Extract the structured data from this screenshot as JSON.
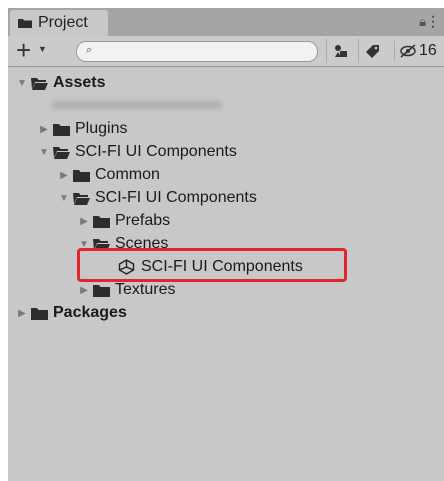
{
  "window": {
    "tab_title": "Project",
    "hidden_count": "16"
  },
  "toolbar": {
    "create_label": "+",
    "search": {
      "placeholder": "",
      "icon": "search-icon"
    }
  },
  "tree": {
    "assets": "Assets",
    "plugins": "Plugins",
    "scifi_root": "SCI-FI UI Components",
    "common": "Common",
    "scifi_sub": "SCI-FI UI Components",
    "prefabs": "Prefabs",
    "scenes": "Scenes",
    "scene_file": "SCI-FI UI Components",
    "textures": "Textures",
    "packages": "Packages"
  },
  "colors": {
    "panel_bg": "#c8c8c8",
    "tab_strip": "#a5a5a5",
    "highlight": "#e0262b",
    "folder_dark": "#2d2d2d"
  }
}
